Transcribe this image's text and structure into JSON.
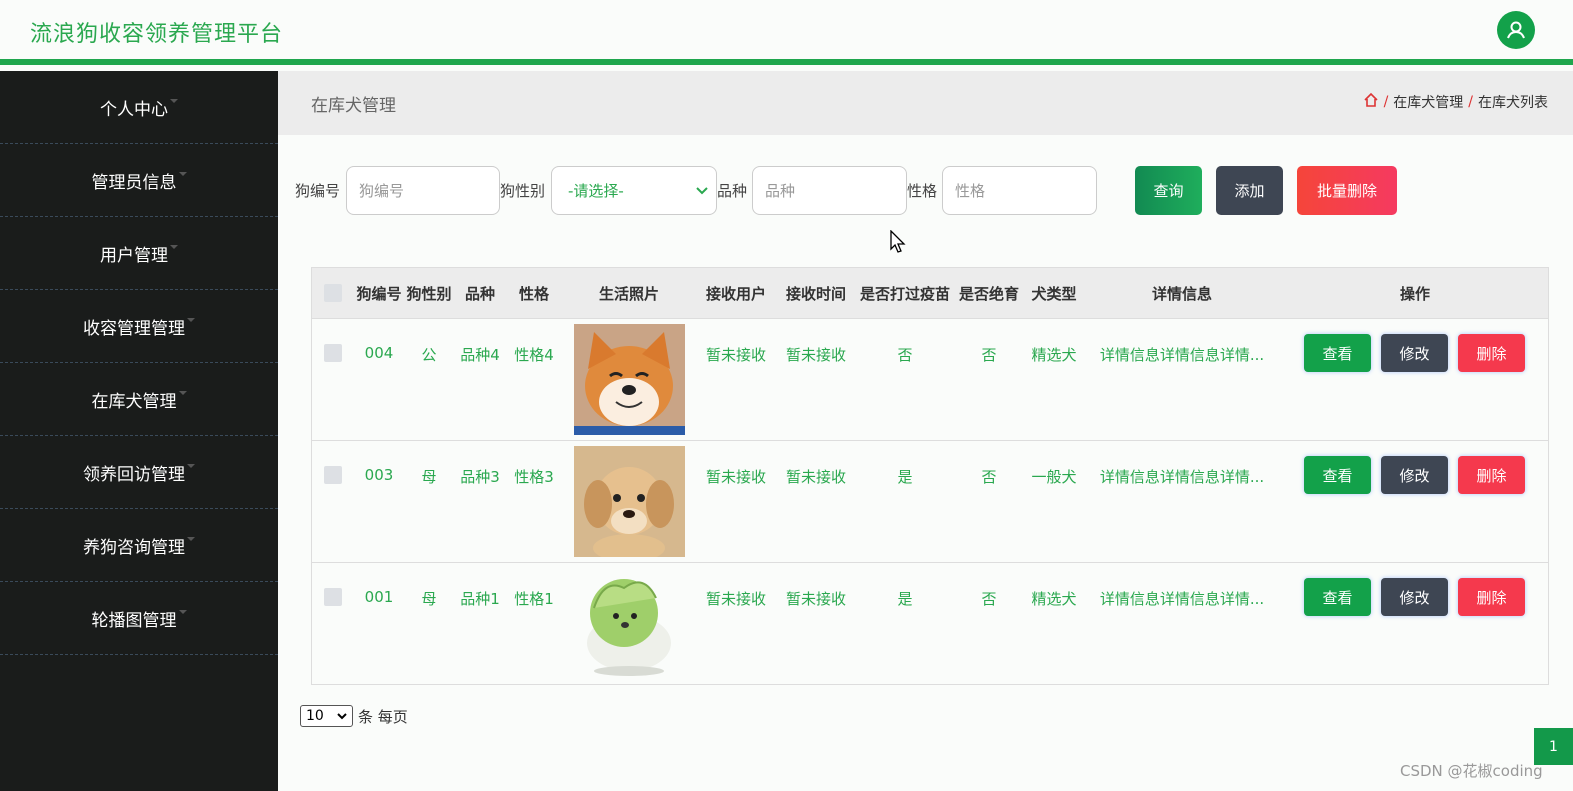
{
  "app_title": "流浪狗收容领养管理平台",
  "sidebar": {
    "items": [
      {
        "label": "个人中心"
      },
      {
        "label": "管理员信息"
      },
      {
        "label": "用户管理"
      },
      {
        "label": "收容管理管理"
      },
      {
        "label": "在库犬管理"
      },
      {
        "label": "领养回访管理"
      },
      {
        "label": "养狗咨询管理"
      },
      {
        "label": "轮播图管理"
      }
    ]
  },
  "page_title": "在库犬管理",
  "breadcrumb": [
    "在库犬管理",
    "在库犬列表"
  ],
  "search": {
    "dog_no_label": "狗编号",
    "dog_no_placeholder": "狗编号",
    "gender_label": "狗性别",
    "gender_value": "-请选择-",
    "breed_label": "品种",
    "breed_placeholder": "品种",
    "temper_label": "性格",
    "temper_placeholder": "性格",
    "query_label": "查询",
    "add_label": "添加",
    "batch_delete_label": "批量删除"
  },
  "table": {
    "headers": [
      "狗编号",
      "狗性别",
      "品种",
      "性格",
      "生活照片",
      "接收用户",
      "接收时间",
      "是否打过疫苗",
      "是否绝育",
      "犬类型",
      "详情信息",
      "操作"
    ],
    "rows": [
      {
        "no": "004",
        "gender": "公",
        "breed": "品种4",
        "temper": "性格4",
        "photo": "shiba",
        "user": "暂未接收",
        "time": "暂未接收",
        "vaccinated": "否",
        "neutered": "否",
        "type": "精选犬",
        "detail": "详情信息详情信息详情..."
      },
      {
        "no": "003",
        "gender": "母",
        "breed": "品种3",
        "temper": "性格3",
        "photo": "puppy",
        "user": "暂未接收",
        "time": "暂未接收",
        "vaccinated": "是",
        "neutered": "否",
        "type": "一般犬",
        "detail": "详情信息详情信息详情..."
      },
      {
        "no": "001",
        "gender": "母",
        "breed": "品种1",
        "temper": "性格1",
        "photo": "cabbage-dog",
        "user": "暂未接收",
        "time": "暂未接收",
        "vaccinated": "是",
        "neutered": "否",
        "type": "精选犬",
        "detail": "详情信息详情信息详情..."
      }
    ],
    "view_label": "查看",
    "edit_label": "修改",
    "delete_label": "删除"
  },
  "pager": {
    "page_size": "10",
    "suffix": "条 每页",
    "current_page": "1"
  },
  "watermark": "CSDN @花椒coding",
  "colors": {
    "accent": "#1fa64d",
    "sidebar": "#1a1c1b",
    "danger": "#f5394d",
    "dark_button": "#3e4653"
  }
}
